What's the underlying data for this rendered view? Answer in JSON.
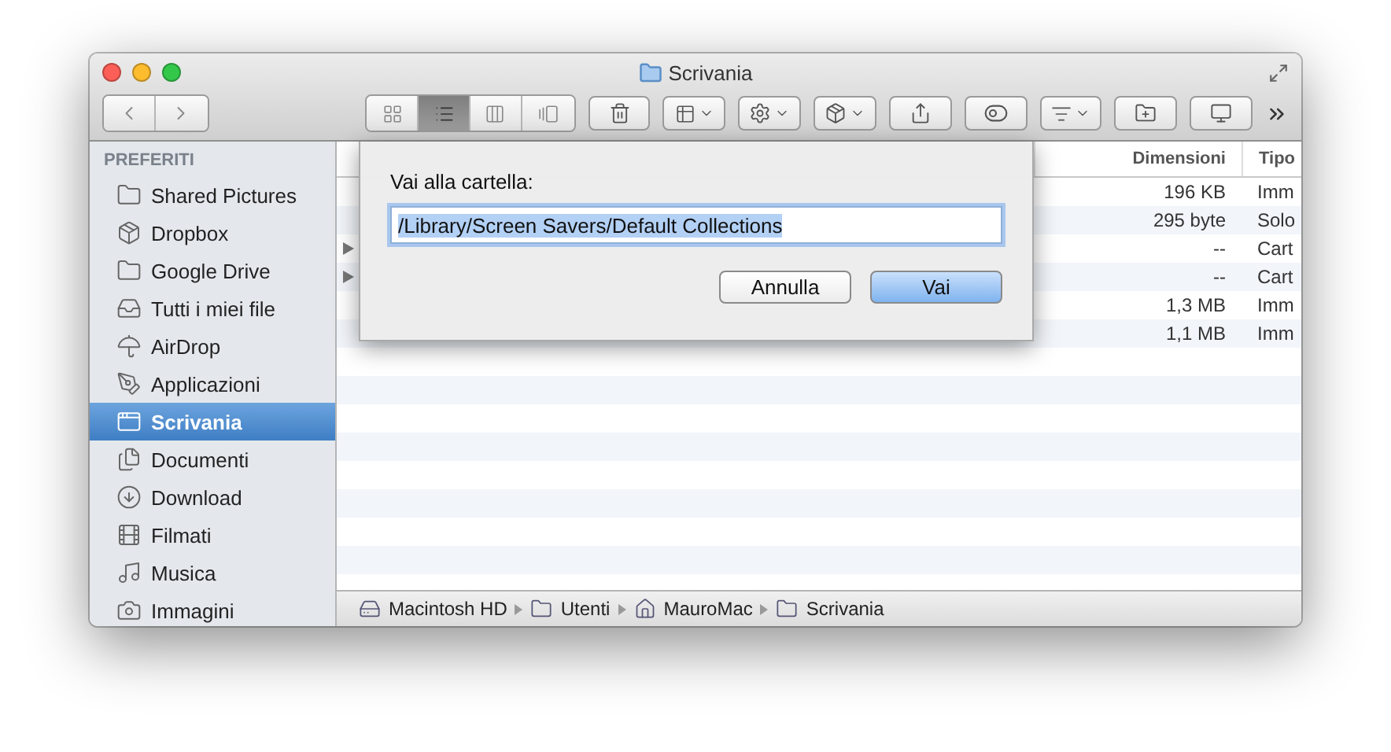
{
  "window": {
    "title": "Scrivania"
  },
  "toolbar": {
    "views": [
      {
        "selected": false
      },
      {
        "selected": true
      },
      {
        "selected": false
      },
      {
        "selected": false
      }
    ]
  },
  "sidebar": {
    "heading": "PREFERITI",
    "items": [
      {
        "label": "Shared Pictures",
        "selected": false
      },
      {
        "label": "Dropbox",
        "selected": false
      },
      {
        "label": "Google Drive",
        "selected": false
      },
      {
        "label": "Tutti i miei file",
        "selected": false
      },
      {
        "label": "AirDrop",
        "selected": false
      },
      {
        "label": "Applicazioni",
        "selected": false
      },
      {
        "label": "Scrivania",
        "selected": true
      },
      {
        "label": "Documenti",
        "selected": false
      },
      {
        "label": "Download",
        "selected": false
      },
      {
        "label": "Filmati",
        "selected": false
      },
      {
        "label": "Musica",
        "selected": false
      },
      {
        "label": "Immagini",
        "selected": false
      }
    ]
  },
  "table": {
    "columns": [
      "Dimensioni",
      "Tipo"
    ],
    "rows": [
      {
        "kind": "file",
        "size": "196 KB",
        "type": "Imm"
      },
      {
        "kind": "file",
        "size": "295 byte",
        "type": "Solo"
      },
      {
        "kind": "folder",
        "expanded": false,
        "size": "--",
        "type": "Cart"
      },
      {
        "kind": "folder",
        "expanded": false,
        "size": "--",
        "type": "Cart"
      },
      {
        "kind": "file",
        "size": "1,3 MB",
        "type": "Imm"
      },
      {
        "kind": "file",
        "size": "1,1 MB",
        "type": "Imm"
      }
    ]
  },
  "dialog": {
    "label": "Vai alla cartella:",
    "value": "/Library/Screen Savers/Default Collections",
    "value_selected": true,
    "buttons": [
      {
        "label": "Annulla",
        "default": false
      },
      {
        "label": "Vai",
        "default": true
      }
    ]
  },
  "path_bar": [
    "Macintosh HD",
    "Utenti",
    "MauroMac",
    "Scrivania"
  ]
}
